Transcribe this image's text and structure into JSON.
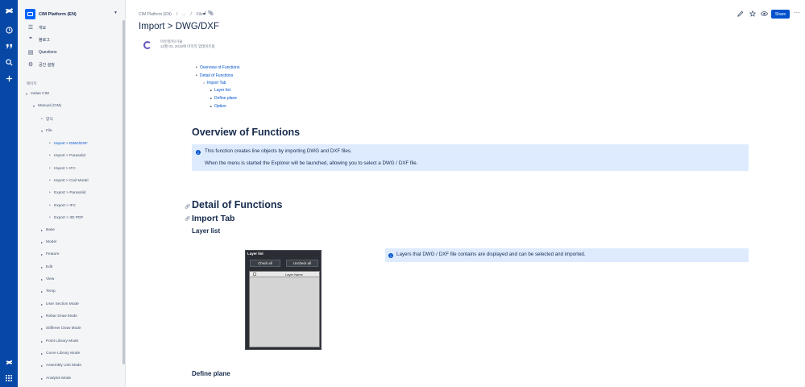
{
  "space": {
    "name": "CIM Platform (EN)"
  },
  "sidebar_nav": [
    {
      "icon": "overview-icon",
      "label": "개요"
    },
    {
      "icon": "blog-icon",
      "label": "블로그"
    },
    {
      "icon": "questions-icon",
      "label": "Questions"
    },
    {
      "icon": "settings-icon",
      "label": "공간 설정"
    }
  ],
  "pages_label": "페이지",
  "tree": [
    {
      "label": "midas CIM",
      "marker": "▾"
    },
    {
      "label": "Manual (CIM)",
      "marker": "▾"
    },
    {
      "label": "양식",
      "marker": "•"
    },
    {
      "label": "File",
      "marker": "▾"
    },
    {
      "label": "Import > DWG/DXF",
      "marker": "•"
    },
    {
      "label": "Import > Parasolid",
      "marker": "•"
    },
    {
      "label": "Import > IFC",
      "marker": "•"
    },
    {
      "label": "Import > Civil Model",
      "marker": "•"
    },
    {
      "label": "Export > Parasolid",
      "marker": "•"
    },
    {
      "label": "Export > IFC",
      "marker": "•"
    },
    {
      "label": "Export > 3D PDF",
      "marker": "•"
    },
    {
      "label": "Base",
      "marker": "▸"
    },
    {
      "label": "Model",
      "marker": "▸"
    },
    {
      "label": "Feature",
      "marker": "▸"
    },
    {
      "label": "Edit",
      "marker": "▸"
    },
    {
      "label": "View",
      "marker": "▸"
    },
    {
      "label": "Temp",
      "marker": "▸"
    },
    {
      "label": "User Section Mode",
      "marker": "▸"
    },
    {
      "label": "Rebar Draw Mode",
      "marker": "▸"
    },
    {
      "label": "Stiffener Draw Mode",
      "marker": "▸"
    },
    {
      "label": "Point Library Mode",
      "marker": "▸"
    },
    {
      "label": "Curve Library Mode",
      "marker": "▸"
    },
    {
      "label": "Assembly Unit Mode",
      "marker": "▸"
    },
    {
      "label": "Analysis Mode",
      "marker": "▸"
    }
  ],
  "breadcrumb": [
    "CIM Platform (EN)",
    "/",
    "...",
    "/",
    "File"
  ],
  "header_actions": {
    "share": "Share"
  },
  "page": {
    "title": "Import > DWG/DXF",
    "author": "마유영/미/기술",
    "date": "12월 03, 2019에 마지막 업데이트됨"
  },
  "toc": [
    "Overview of Functions",
    "Detail of Functions",
    "Import Tab",
    "Layer list",
    "Define plane",
    "Option"
  ],
  "sections": {
    "overview_heading": "Overview of Functions",
    "overview_info_1": "This function creates line objects by importing DWG and DXF files.",
    "overview_info_2": "When the menu is started the Explorer will be launched, allowing you to select a DWG / DXF file.",
    "detail_heading": "Detail of Functions",
    "import_tab_heading": "Import Tab",
    "layer_list_heading": "Layer list",
    "layer_list_info": "Layers that DWG / DXF file contains are displayed and can be selected and imported.",
    "define_plane_heading": "Define plane"
  },
  "layer_dialog": {
    "title": "Layer list",
    "check_all": "Check all",
    "uncheck_all": "Uncheck all",
    "column": "Layer Name"
  },
  "colors": {
    "rail": "#0747a6",
    "accent": "#0052cc",
    "info_bg": "#deebff"
  }
}
